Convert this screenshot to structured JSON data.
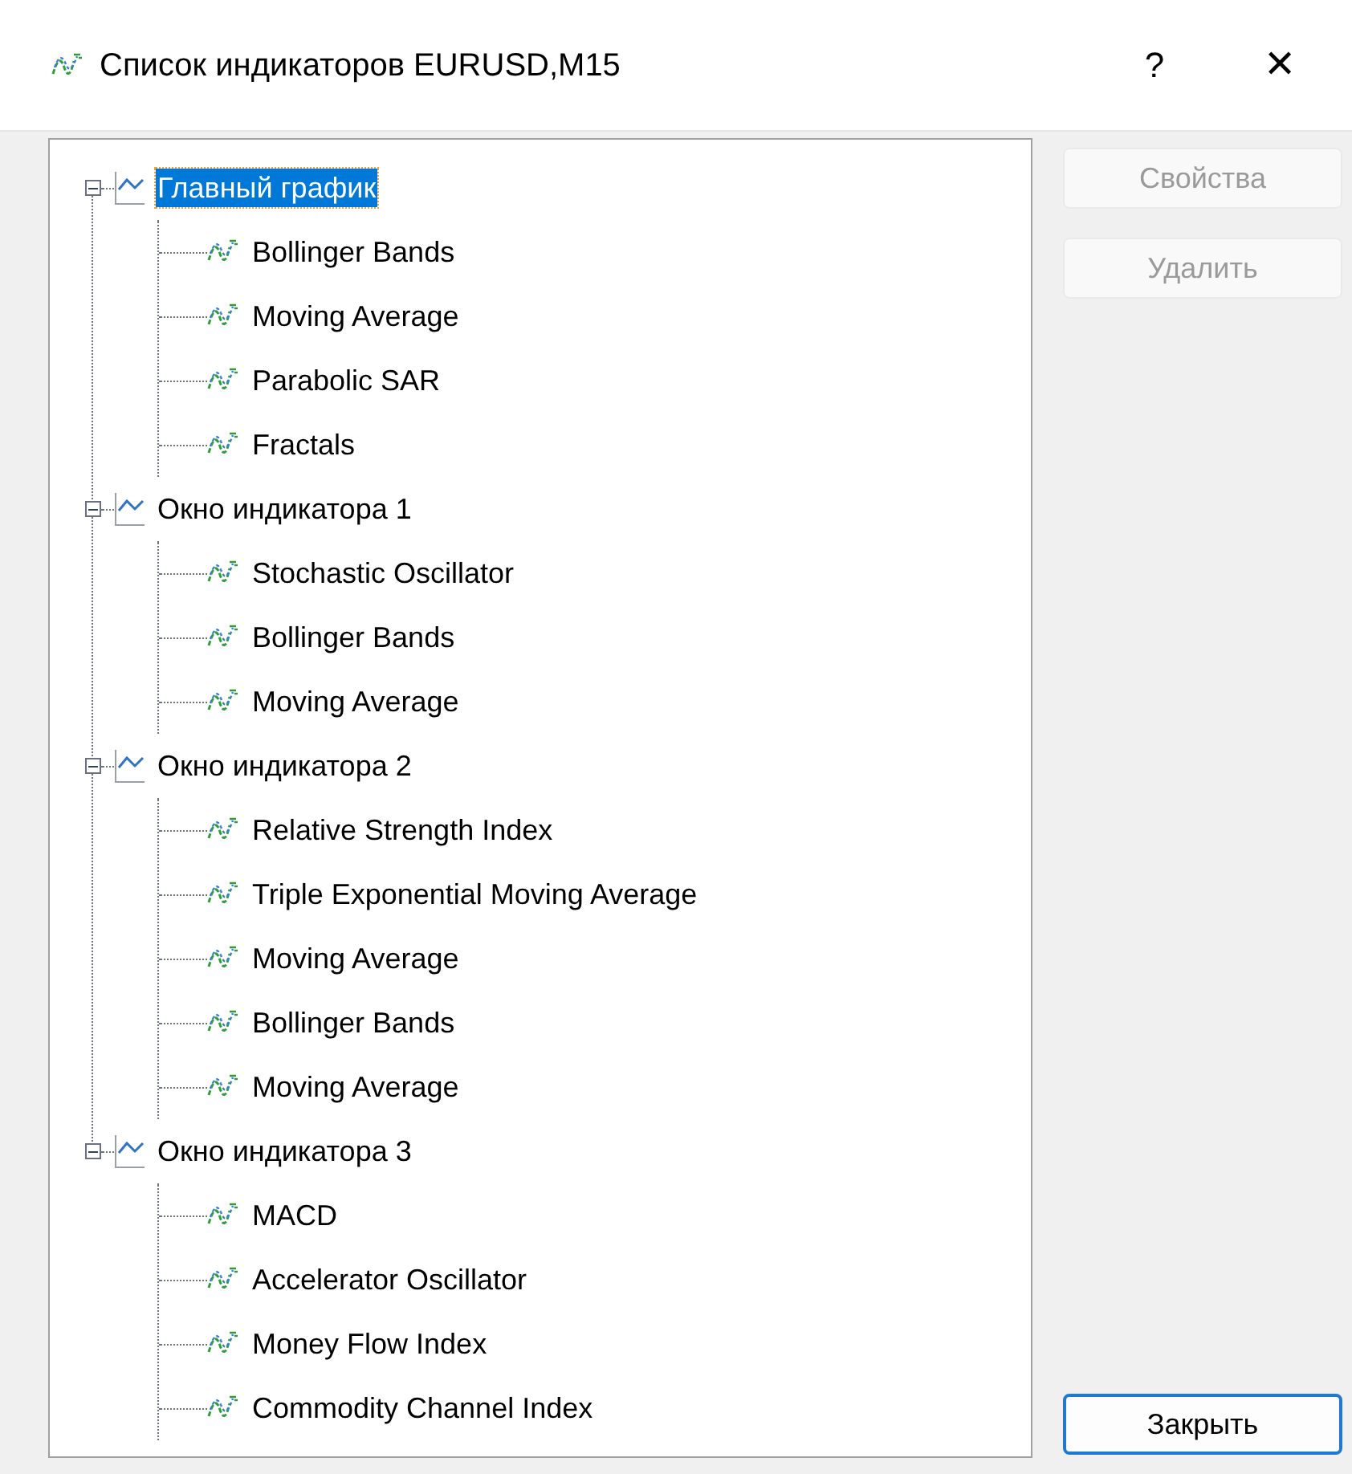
{
  "window": {
    "title": "Список индикаторов EURUSD,M15",
    "help": "?",
    "close": "✕"
  },
  "tree": [
    {
      "label": "Главный график",
      "expanded": true,
      "selected": true,
      "children": [
        {
          "label": "Bollinger Bands"
        },
        {
          "label": "Moving Average"
        },
        {
          "label": "Parabolic SAR"
        },
        {
          "label": "Fractals"
        }
      ]
    },
    {
      "label": "Окно индикатора 1",
      "expanded": true,
      "selected": false,
      "children": [
        {
          "label": "Stochastic Oscillator"
        },
        {
          "label": "Bollinger Bands"
        },
        {
          "label": "Moving Average"
        }
      ]
    },
    {
      "label": "Окно индикатора 2",
      "expanded": true,
      "selected": false,
      "children": [
        {
          "label": "Relative Strength Index"
        },
        {
          "label": "Triple Exponential Moving Average"
        },
        {
          "label": "Moving Average"
        },
        {
          "label": "Bollinger Bands"
        },
        {
          "label": "Moving Average"
        }
      ]
    },
    {
      "label": "Окно индикатора 3",
      "expanded": true,
      "selected": false,
      "children": [
        {
          "label": "MACD"
        },
        {
          "label": "Accelerator Oscillator"
        },
        {
          "label": "Money Flow Index"
        },
        {
          "label": "Commodity Channel Index"
        }
      ]
    }
  ],
  "buttons": [
    {
      "label": "Свойства",
      "disabled": true
    },
    {
      "label": "Удалить",
      "disabled": true
    }
  ],
  "close_button": {
    "label": "Закрыть",
    "disabled": false
  }
}
